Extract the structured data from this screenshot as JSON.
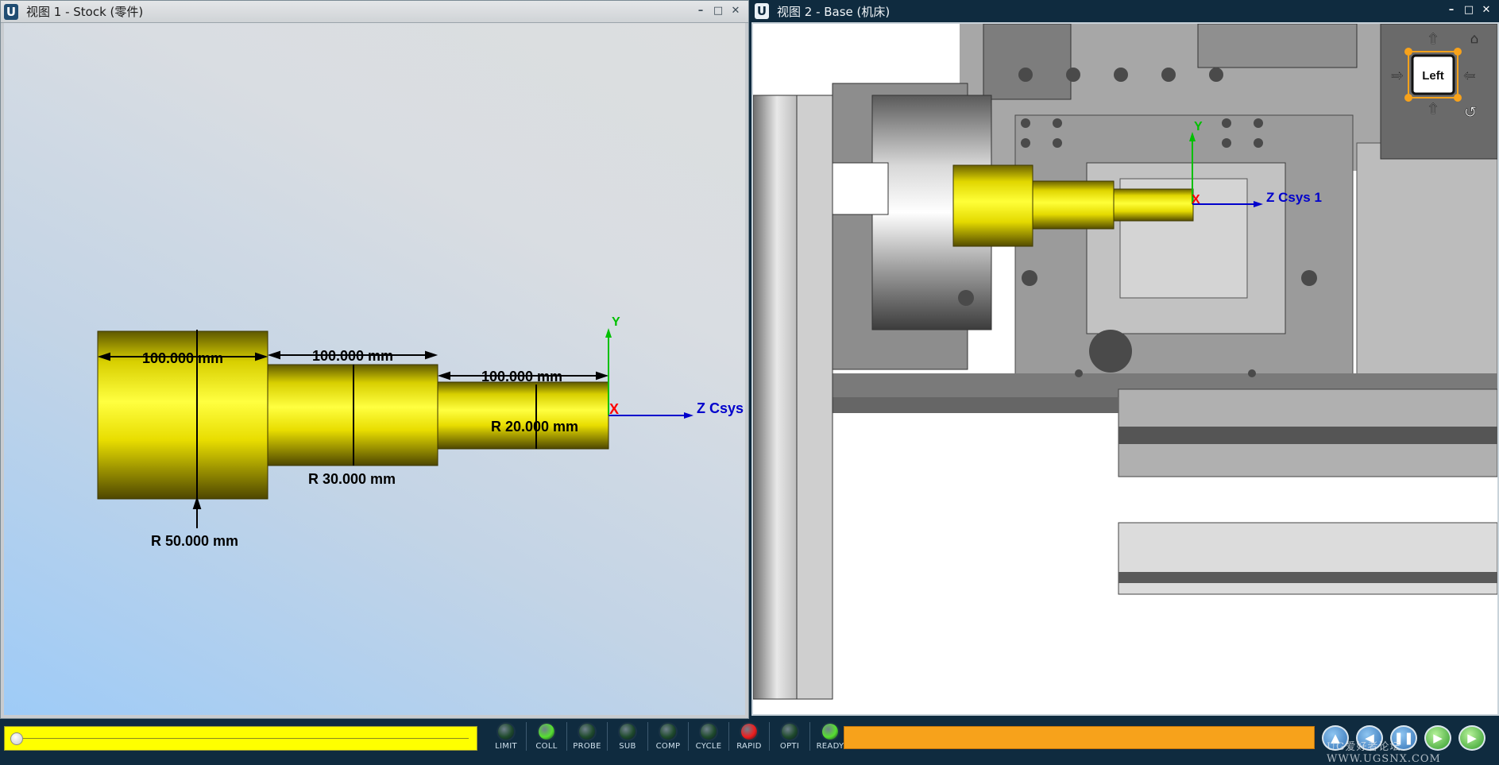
{
  "view1": {
    "title": "视图 1 - Stock (零件)",
    "logo": "U",
    "controls": [
      "minimize-icon",
      "maximize-icon",
      "close-icon"
    ],
    "dimensions": {
      "len1": "100.000 mm",
      "len2": "100.000 mm",
      "len3": "100.000 mm",
      "r1": "R 50.000 mm",
      "r2": "R 30.000 mm",
      "r3": "R 20.000 mm"
    },
    "axes": {
      "y": "Y",
      "x": "X",
      "z": "Z Csys"
    }
  },
  "view2": {
    "title": "视图 2 - Base (机床)",
    "logo": "U",
    "controls": [
      "minimize-icon",
      "maximize-icon",
      "close-icon"
    ],
    "viewcube": {
      "face": "Left"
    },
    "axes": {
      "y": "Y",
      "x": "X",
      "z": "Z Csys 1"
    }
  },
  "bottombar": {
    "progress": 0.0,
    "indicators": [
      {
        "label": "LIMIT",
        "color": "#1f4a2c"
      },
      {
        "label": "COLL",
        "color": "#56e030"
      },
      {
        "label": "PROBE",
        "color": "#1f4a2c"
      },
      {
        "label": "SUB",
        "color": "#1f4a2c"
      },
      {
        "label": "COMP",
        "color": "#1f4a2c"
      },
      {
        "label": "CYCLE",
        "color": "#1f4a2c"
      },
      {
        "label": "RAPID",
        "color": "#f01c1c"
      },
      {
        "label": "OPTI",
        "color": "#1f4a2c"
      },
      {
        "label": "READY",
        "color": "#56e030"
      }
    ],
    "transport_icons": [
      "step-back-icon",
      "rewind-icon",
      "pause-icon",
      "step-forward-icon",
      "play-icon"
    ],
    "watermark": "UG爱好者论坛 WWW.UGSNX.COM"
  },
  "colors": {
    "part_yellow": "#f3ea00",
    "axis_y": "#00c000",
    "axis_x": "#ff0000",
    "axis_z": "#0000cc",
    "status_orange": "#f7a21b",
    "progress_yellow": "#ffff00"
  }
}
